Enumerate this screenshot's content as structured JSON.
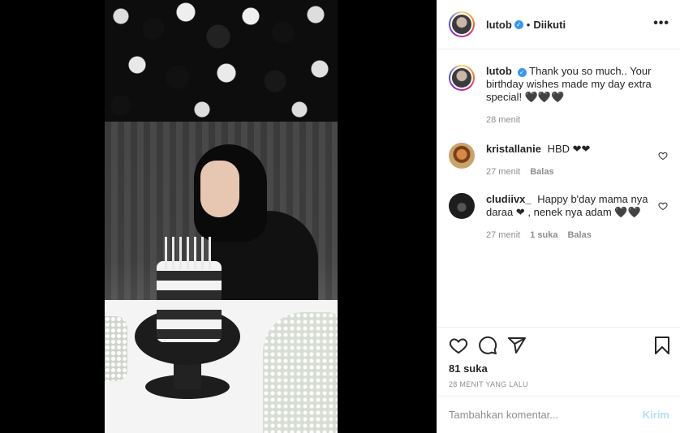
{
  "post": {
    "author": "lutob",
    "follow_state": "Diikuti",
    "more_label": "•••"
  },
  "caption": {
    "username": "lutob",
    "text": "Thank you so much.. Your birthday wishes made my day extra special! 🖤🖤🖤",
    "time": "28 menit"
  },
  "comments": [
    {
      "username": "kristallanie",
      "text": "HBD ❤❤",
      "time": "27 menit",
      "likes": "",
      "reply": "Balas"
    },
    {
      "username": "cludiivx_",
      "text": "Happy b'day mama nya daraa ❤ , nenek nya adam 🖤🖤",
      "time": "27 menit",
      "likes": "1 suka",
      "reply": "Balas"
    }
  ],
  "stats": {
    "likes": "81 suka",
    "posted": "28 MENIT YANG LALU"
  },
  "composer": {
    "placeholder": "Tambahkan komentar...",
    "post_label": "Kirim"
  },
  "colors": {
    "verified": "#3897f0",
    "post_disabled": "#b2dffc",
    "secondary_text": "#8e8e8e"
  }
}
